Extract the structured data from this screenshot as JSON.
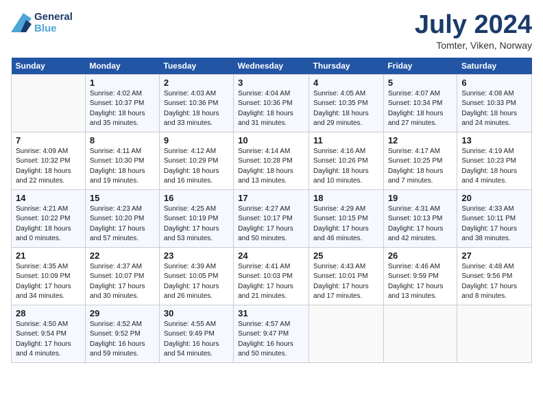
{
  "header": {
    "logo_line1": "General",
    "logo_line2": "Blue",
    "title": "July 2024",
    "location": "Tomter, Viken, Norway"
  },
  "columns": [
    "Sunday",
    "Monday",
    "Tuesday",
    "Wednesday",
    "Thursday",
    "Friday",
    "Saturday"
  ],
  "weeks": [
    [
      {
        "day": "",
        "info": ""
      },
      {
        "day": "1",
        "info": "Sunrise: 4:02 AM\nSunset: 10:37 PM\nDaylight: 18 hours\nand 35 minutes."
      },
      {
        "day": "2",
        "info": "Sunrise: 4:03 AM\nSunset: 10:36 PM\nDaylight: 18 hours\nand 33 minutes."
      },
      {
        "day": "3",
        "info": "Sunrise: 4:04 AM\nSunset: 10:36 PM\nDaylight: 18 hours\nand 31 minutes."
      },
      {
        "day": "4",
        "info": "Sunrise: 4:05 AM\nSunset: 10:35 PM\nDaylight: 18 hours\nand 29 minutes."
      },
      {
        "day": "5",
        "info": "Sunrise: 4:07 AM\nSunset: 10:34 PM\nDaylight: 18 hours\nand 27 minutes."
      },
      {
        "day": "6",
        "info": "Sunrise: 4:08 AM\nSunset: 10:33 PM\nDaylight: 18 hours\nand 24 minutes."
      }
    ],
    [
      {
        "day": "7",
        "info": "Sunrise: 4:09 AM\nSunset: 10:32 PM\nDaylight: 18 hours\nand 22 minutes."
      },
      {
        "day": "8",
        "info": "Sunrise: 4:11 AM\nSunset: 10:30 PM\nDaylight: 18 hours\nand 19 minutes."
      },
      {
        "day": "9",
        "info": "Sunrise: 4:12 AM\nSunset: 10:29 PM\nDaylight: 18 hours\nand 16 minutes."
      },
      {
        "day": "10",
        "info": "Sunrise: 4:14 AM\nSunset: 10:28 PM\nDaylight: 18 hours\nand 13 minutes."
      },
      {
        "day": "11",
        "info": "Sunrise: 4:16 AM\nSunset: 10:26 PM\nDaylight: 18 hours\nand 10 minutes."
      },
      {
        "day": "12",
        "info": "Sunrise: 4:17 AM\nSunset: 10:25 PM\nDaylight: 18 hours\nand 7 minutes."
      },
      {
        "day": "13",
        "info": "Sunrise: 4:19 AM\nSunset: 10:23 PM\nDaylight: 18 hours\nand 4 minutes."
      }
    ],
    [
      {
        "day": "14",
        "info": "Sunrise: 4:21 AM\nSunset: 10:22 PM\nDaylight: 18 hours\nand 0 minutes."
      },
      {
        "day": "15",
        "info": "Sunrise: 4:23 AM\nSunset: 10:20 PM\nDaylight: 17 hours\nand 57 minutes."
      },
      {
        "day": "16",
        "info": "Sunrise: 4:25 AM\nSunset: 10:19 PM\nDaylight: 17 hours\nand 53 minutes."
      },
      {
        "day": "17",
        "info": "Sunrise: 4:27 AM\nSunset: 10:17 PM\nDaylight: 17 hours\nand 50 minutes."
      },
      {
        "day": "18",
        "info": "Sunrise: 4:29 AM\nSunset: 10:15 PM\nDaylight: 17 hours\nand 46 minutes."
      },
      {
        "day": "19",
        "info": "Sunrise: 4:31 AM\nSunset: 10:13 PM\nDaylight: 17 hours\nand 42 minutes."
      },
      {
        "day": "20",
        "info": "Sunrise: 4:33 AM\nSunset: 10:11 PM\nDaylight: 17 hours\nand 38 minutes."
      }
    ],
    [
      {
        "day": "21",
        "info": "Sunrise: 4:35 AM\nSunset: 10:09 PM\nDaylight: 17 hours\nand 34 minutes."
      },
      {
        "day": "22",
        "info": "Sunrise: 4:37 AM\nSunset: 10:07 PM\nDaylight: 17 hours\nand 30 minutes."
      },
      {
        "day": "23",
        "info": "Sunrise: 4:39 AM\nSunset: 10:05 PM\nDaylight: 17 hours\nand 26 minutes."
      },
      {
        "day": "24",
        "info": "Sunrise: 4:41 AM\nSunset: 10:03 PM\nDaylight: 17 hours\nand 21 minutes."
      },
      {
        "day": "25",
        "info": "Sunrise: 4:43 AM\nSunset: 10:01 PM\nDaylight: 17 hours\nand 17 minutes."
      },
      {
        "day": "26",
        "info": "Sunrise: 4:46 AM\nSunset: 9:59 PM\nDaylight: 17 hours\nand 13 minutes."
      },
      {
        "day": "27",
        "info": "Sunrise: 4:48 AM\nSunset: 9:56 PM\nDaylight: 17 hours\nand 8 minutes."
      }
    ],
    [
      {
        "day": "28",
        "info": "Sunrise: 4:50 AM\nSunset: 9:54 PM\nDaylight: 17 hours\nand 4 minutes."
      },
      {
        "day": "29",
        "info": "Sunrise: 4:52 AM\nSunset: 9:52 PM\nDaylight: 16 hours\nand 59 minutes."
      },
      {
        "day": "30",
        "info": "Sunrise: 4:55 AM\nSunset: 9:49 PM\nDaylight: 16 hours\nand 54 minutes."
      },
      {
        "day": "31",
        "info": "Sunrise: 4:57 AM\nSunset: 9:47 PM\nDaylight: 16 hours\nand 50 minutes."
      },
      {
        "day": "",
        "info": ""
      },
      {
        "day": "",
        "info": ""
      },
      {
        "day": "",
        "info": ""
      }
    ]
  ]
}
